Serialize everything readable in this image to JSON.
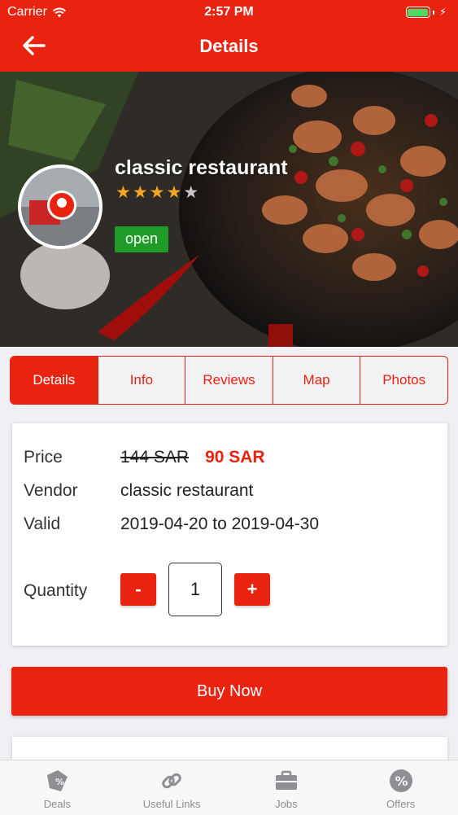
{
  "status_bar": {
    "carrier": "Carrier",
    "time": "2:57 PM"
  },
  "nav": {
    "title": "Details"
  },
  "restaurant": {
    "name": "classic restaurant",
    "rating": 4,
    "rating_max": 5,
    "status": "open"
  },
  "tabs": [
    {
      "label": "Details",
      "active": true
    },
    {
      "label": "Info",
      "active": false
    },
    {
      "label": "Reviews",
      "active": false
    },
    {
      "label": "Map",
      "active": false
    },
    {
      "label": "Photos",
      "active": false
    }
  ],
  "details": {
    "price_label": "Price",
    "old_price": "144 SAR",
    "new_price": "90 SAR",
    "vendor_label": "Vendor",
    "vendor_value": "classic restaurant",
    "valid_label": "Valid",
    "valid_from": "2019-04-20",
    "valid_to_word": "to",
    "valid_to": "2019-04-30",
    "quantity_label": "Quantity",
    "minus": "-",
    "quantity": "1",
    "plus": "+"
  },
  "buy_label": "Buy Now",
  "tabbar": [
    {
      "label": "Deals",
      "icon": "deals-tag-icon"
    },
    {
      "label": "Useful Links",
      "icon": "link-icon"
    },
    {
      "label": "Jobs",
      "icon": "briefcase-icon"
    },
    {
      "label": "Offers",
      "icon": "percent-badge-icon"
    }
  ],
  "colors": {
    "accent": "#e8230f",
    "open_badge": "#1f9c27",
    "star": "#f5a623"
  }
}
